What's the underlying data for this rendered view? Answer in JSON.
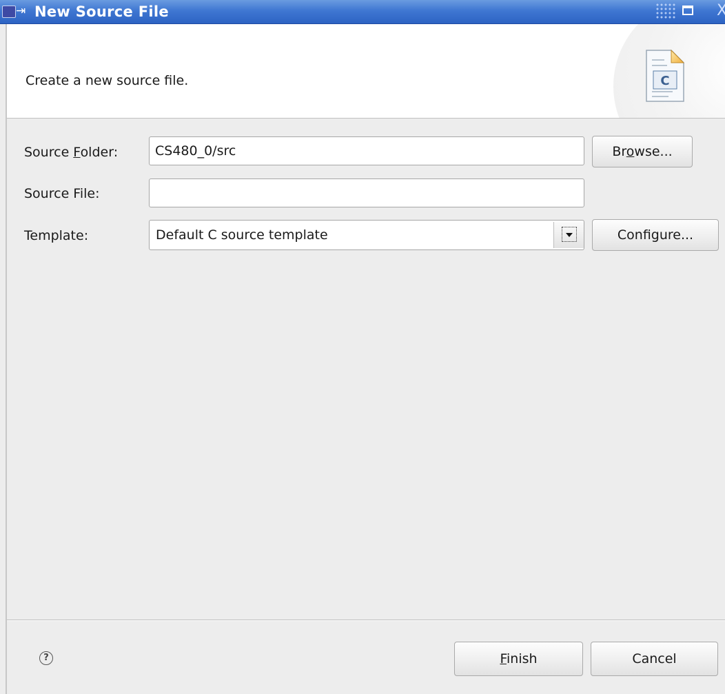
{
  "window": {
    "title": "New Source File",
    "pin_glyph": "⇥",
    "close_glyph": "X"
  },
  "header": {
    "message": "Create a new source file.",
    "icon": "c-source-file-icon",
    "icon_letter": "C"
  },
  "form": {
    "source_folder": {
      "label_before": "Source ",
      "label_mnemonic": "F",
      "label_after": "older:",
      "value": "CS480_0/src",
      "browse_before": "Br",
      "browse_mnemonic": "o",
      "browse_after": "wse..."
    },
    "source_file": {
      "label": "Source File:",
      "value": ""
    },
    "template": {
      "label": "Template:",
      "selected": "Default C source template",
      "configure_label": "Configure..."
    }
  },
  "footer": {
    "help_glyph": "?",
    "finish_mnemonic": "F",
    "finish_after": "inish",
    "cancel_label": "Cancel"
  },
  "colors": {
    "titlebar": "#3f77d2",
    "dialog_bg": "#ededed",
    "header_bg": "#ffffff"
  }
}
